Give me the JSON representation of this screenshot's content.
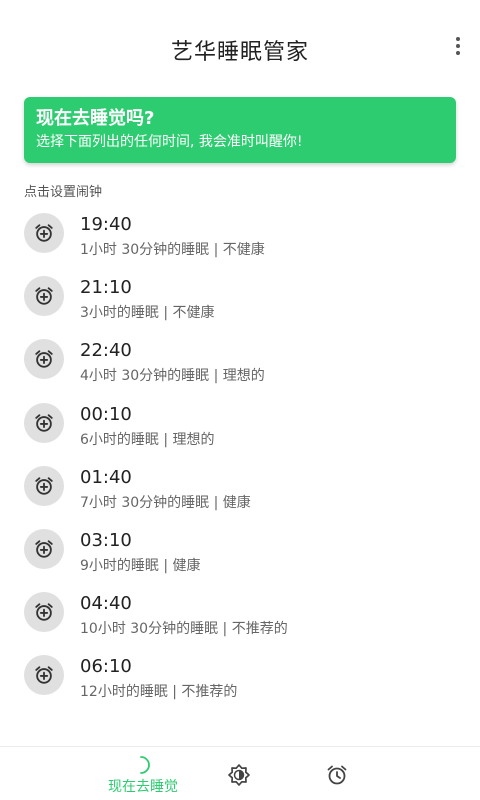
{
  "app": {
    "title": "艺华睡眠管家"
  },
  "banner": {
    "title": "现在去睡觉吗?",
    "subtitle": "选择下面列出的任何时间, 我会准时叫醒你!"
  },
  "section_label": "点击设置闹钟",
  "alarms": [
    {
      "time": "19:40",
      "desc": "1小时 30分钟的睡眠 | 不健康"
    },
    {
      "time": "21:10",
      "desc": "3小时的睡眠 | 不健康"
    },
    {
      "time": "22:40",
      "desc": "4小时 30分钟的睡眠 | 理想的"
    },
    {
      "time": "00:10",
      "desc": "6小时的睡眠 | 理想的"
    },
    {
      "time": "01:40",
      "desc": "7小时 30分钟的睡眠 | 健康"
    },
    {
      "time": "03:10",
      "desc": "9小时的睡眠 | 健康"
    },
    {
      "time": "04:40",
      "desc": "10小时 30分钟的睡眠 | 不推荐的"
    },
    {
      "time": "06:10",
      "desc": "12小时的睡眠 | 不推荐的"
    }
  ],
  "bottom_nav": {
    "sleep_now_label": "现在去睡觉",
    "items": [
      "moon-icon",
      "sun-icon",
      "alarm-clock-icon"
    ]
  },
  "colors": {
    "accent": "#2ecc71",
    "icon_bg": "#e0e0e0"
  }
}
